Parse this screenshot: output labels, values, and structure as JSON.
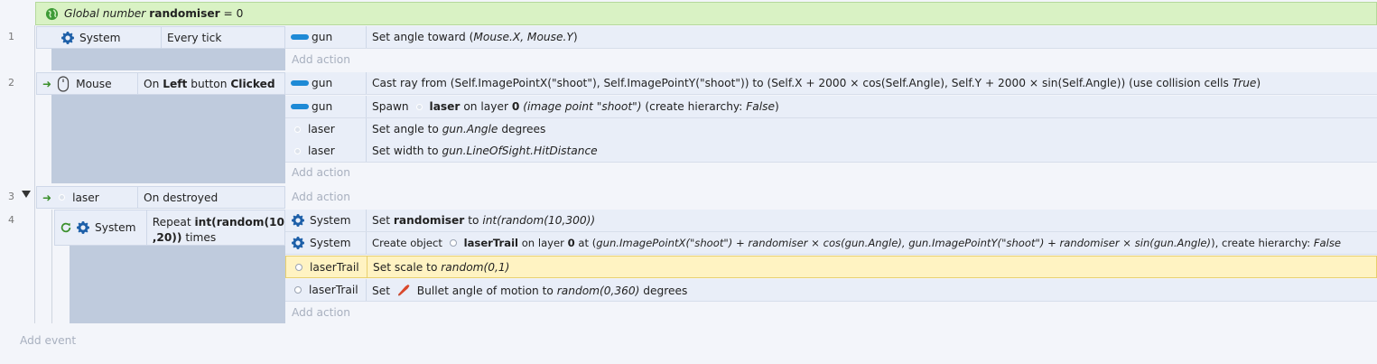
{
  "global": {
    "prefix": "Global number",
    "name": "randomiser",
    "suffix": "= 0"
  },
  "line_numbers": [
    "1",
    "2",
    "3",
    "4"
  ],
  "events": [
    {
      "object": "System",
      "condition": "Every tick",
      "actions": [
        {
          "object": "gun",
          "text": "Set angle toward (",
          "italic": "Mouse.X, Mouse.Y",
          "tail": ")"
        }
      ],
      "add_action": "Add action"
    },
    {
      "object": "Mouse",
      "condition": {
        "a": "On",
        "b": "Left",
        "c": "button",
        "d": "Clicked"
      },
      "actions": [
        {
          "object": "gun",
          "text": "Cast ray from (Self.ImagePointX(\"shoot\"), Self.ImagePointY(\"shoot\")) to (Self.X + 2000 × cos(Self.Angle), Self.Y + 2000 × sin(Self.Angle)) (use collision cells",
          "italic": "True",
          "tail": ")"
        },
        {
          "object": "gun",
          "verb": "Spawn",
          "target": "laser",
          "mid": "on layer",
          "layer": "0",
          "italic": "(image point \"shoot\")",
          "tail": "(create hierarchy:",
          "tail_italic": "False",
          "tail_end": ")"
        },
        {
          "object": "laser",
          "text": "Set angle to",
          "italic": "gun.Angle",
          "tail": "degrees"
        },
        {
          "object": "laser",
          "text": "Set width to",
          "italic": "gun.LineOfSight.HitDistance",
          "tail": ""
        }
      ],
      "add_action": "Add action"
    },
    {
      "object": "laser",
      "condition": "On destroyed",
      "add_action": "Add action"
    },
    {
      "object": "System",
      "condition": {
        "pre": "Repeat",
        "bold1": "int(random(10",
        "bold2": ",20))",
        "post": "times"
      },
      "actions": [
        {
          "object": "System",
          "text": "Set",
          "bold": "randomiser",
          "mid": "to",
          "italic": "int(random(10,300))"
        },
        {
          "object": "System",
          "text": "Create object",
          "target": "laserTrail",
          "mid": "on layer",
          "layer": "0",
          "at": "at (",
          "italic": "gun.ImagePointX(\"shoot\") + randomiser × cos(gun.Angle), gun.ImagePointY(\"shoot\") + randomiser × sin(gun.Angle)",
          "tail": "), create hierarchy:",
          "tail_italic": "False"
        },
        {
          "object": "laserTrail",
          "text": "Set scale to",
          "italic": "random(0,1)"
        },
        {
          "object": "laserTrail",
          "text": "Set",
          "mid": "Bullet angle of motion to",
          "italic": "random(0,360)",
          "tail": "degrees"
        }
      ],
      "add_action": "Add action"
    }
  ],
  "add_event": "Add event",
  "colors": {
    "global_bg": "#d9f2c4",
    "accent_blue": "#1e8ad6",
    "arrow_green": "#3a8f2b",
    "highlight": "#fff3c2"
  }
}
